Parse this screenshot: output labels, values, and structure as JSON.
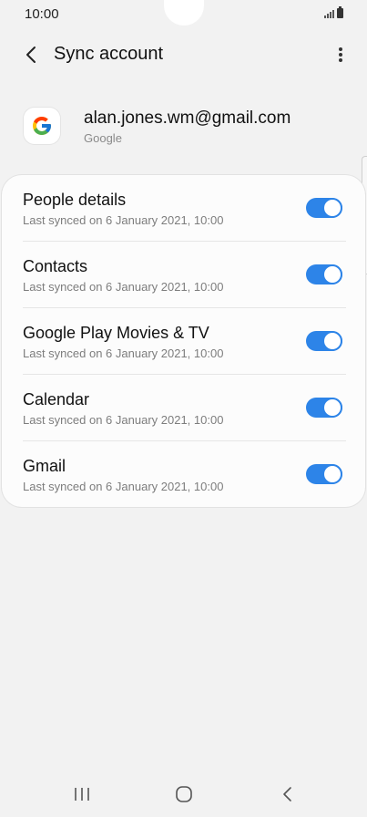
{
  "status_bar": {
    "time": "10:00",
    "signal_icon": "signal-icon",
    "battery_icon": "battery-icon"
  },
  "app_bar": {
    "title": "Sync account",
    "back_icon": "chevron-left-icon",
    "more_icon": "more-vertical-icon"
  },
  "account": {
    "email": "alan.jones.wm@gmail.com",
    "type": "Google",
    "logo": "google-logo"
  },
  "sync_items": [
    {
      "title": "People details",
      "subtitle": "Last synced on 6 January 2021, 10:00",
      "enabled": true
    },
    {
      "title": "Contacts",
      "subtitle": "Last synced on 6 January 2021, 10:00",
      "enabled": true
    },
    {
      "title": "Google Play Movies & TV",
      "subtitle": "Last synced on 6 January 2021, 10:00",
      "enabled": true
    },
    {
      "title": "Calendar",
      "subtitle": "Last synced on 6 January 2021, 10:00",
      "enabled": true
    },
    {
      "title": "Gmail",
      "subtitle": "Last synced on 6 January 2021, 10:00",
      "enabled": true
    }
  ],
  "nav_bar": {
    "recents_icon": "recents-icon",
    "home_icon": "home-icon",
    "back_icon": "back-icon"
  },
  "colors": {
    "background": "#f2f2f2",
    "card": "#fcfcfc",
    "accent": "#2d84e8",
    "subtext": "#7d7d7d"
  }
}
